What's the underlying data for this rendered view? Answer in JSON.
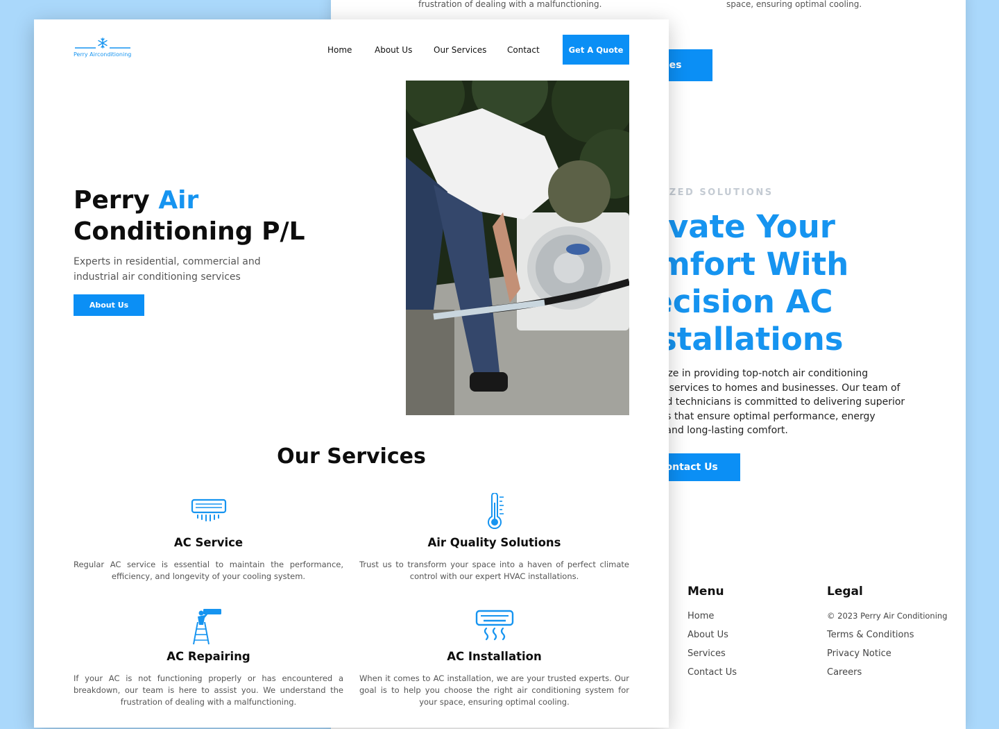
{
  "back_page": {
    "top_left_text": "frustration of dealing with a malfunctioning.",
    "top_right_text": "space, ensuring optimal cooling.",
    "services_button_partial": "ices",
    "eyebrow_partial": "TOMIZED SOLUTIONS",
    "heading_lines": [
      "levate Your",
      "omfort With",
      "recision AC",
      "nstallations"
    ],
    "paragraph_lines": [
      "pecialize in providing top-notch air conditioning",
      "llation services to homes and businesses. Our team of",
      "rienced technicians is committed to delivering superior",
      "llations that ensure optimal performance, energy",
      "ency, and long-lasting comfort."
    ],
    "contact_button_partial": "Contact Us",
    "footer": {
      "menu": {
        "title": "Menu",
        "items": [
          "Home",
          "About Us",
          "Services",
          "Contact Us"
        ]
      },
      "legal": {
        "title": "Legal",
        "items": [
          "© 2023 Perry Air Conditioning",
          "Terms & Conditions",
          "Privacy Notice",
          "Careers"
        ]
      }
    }
  },
  "front_page": {
    "logo": {
      "text": "Perry Airconditioning",
      "icon": "snowflake-icon"
    },
    "nav": [
      "Home",
      "About Us",
      "Our Services",
      "Contact"
    ],
    "cta_button": "Get A Quote",
    "hero": {
      "title_part1": "Perry ",
      "title_accent": "Air",
      "title_line2": "Conditioning P/L",
      "subtitle": "Experts in residential, commercial and industrial air conditioning services",
      "button": "About Us"
    },
    "services_title": "Our Services",
    "services": [
      {
        "title": "AC Service",
        "icon": "ac-unit-icon",
        "desc": "Regular AC service is essential to maintain the performance, efficiency, and longevity of your cooling system."
      },
      {
        "title": "Air Quality Solutions",
        "icon": "thermometer-icon",
        "desc": "Trust us to transform your space into a haven of perfect climate control with our expert HVAC installations."
      },
      {
        "title": "AC Repairing",
        "icon": "technician-ladder-icon",
        "desc": "If your AC is not functioning properly or has encountered a breakdown, our team is here to assist you. We understand the frustration of dealing with a malfunctioning."
      },
      {
        "title": "AC Installation",
        "icon": "ac-airflow-icon",
        "desc": "When it comes to AC installation, we are your trusted experts. Our goal is to help you choose the right air conditioning system for your space, ensuring optimal cooling."
      }
    ]
  },
  "colors": {
    "background": "#aad8fb",
    "accent": "#0b8ff5",
    "heading_blue": "#1694f0"
  }
}
